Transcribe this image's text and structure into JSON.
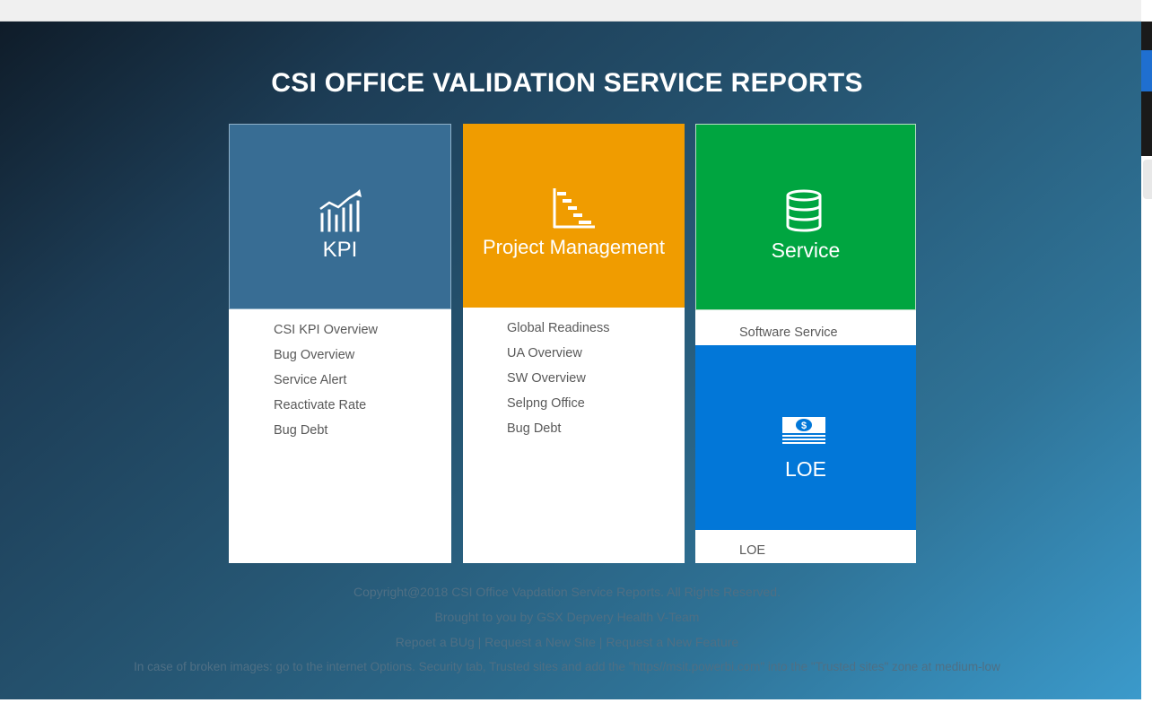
{
  "page": {
    "title": "CSI OFFICE VALIDATION SERVICE REPORTS"
  },
  "colors": {
    "kpi_tile": "#386d94",
    "project_tile": "#f09c00",
    "service_tile": "#00a540",
    "loe_tile": "#0277d8"
  },
  "cards": {
    "kpi": {
      "label": "KPI",
      "icon": "bar-chart-trend-icon",
      "links": [
        "CSI KPI Overview",
        "Bug Overview",
        "Service Alert",
        "Reactivate Rate",
        "Bug Debt"
      ]
    },
    "project": {
      "label": "Project Management",
      "icon": "gantt-chart-icon",
      "links": [
        "Global Readiness",
        "UA Overview",
        "SW Overview",
        "Selpng Office",
        "Bug Debt"
      ]
    },
    "service": {
      "label": "Service",
      "icon": "database-icon",
      "links": [
        "Software Service"
      ]
    },
    "loe": {
      "label": "LOE",
      "icon": "money-stack-icon",
      "links": [
        "LOE"
      ]
    }
  },
  "footer": {
    "copyright": "Copyright@2018 CSI Office Vapdation Service Reports. All Rights Reserved.",
    "credits": "Brought to you by GSX Depvery Health V-Team",
    "links": {
      "report_bug": "Repoet a BUg",
      "separator": " | ",
      "request_site": "Request a New Site",
      "request_feature": "Request a New Feature"
    },
    "note": "In case of broken images: go to the internet Options. Security tab, Trusted sites and add the \"https//msit.powerbi.com\" into the \"Trusted sites\" zone at medium-low"
  }
}
